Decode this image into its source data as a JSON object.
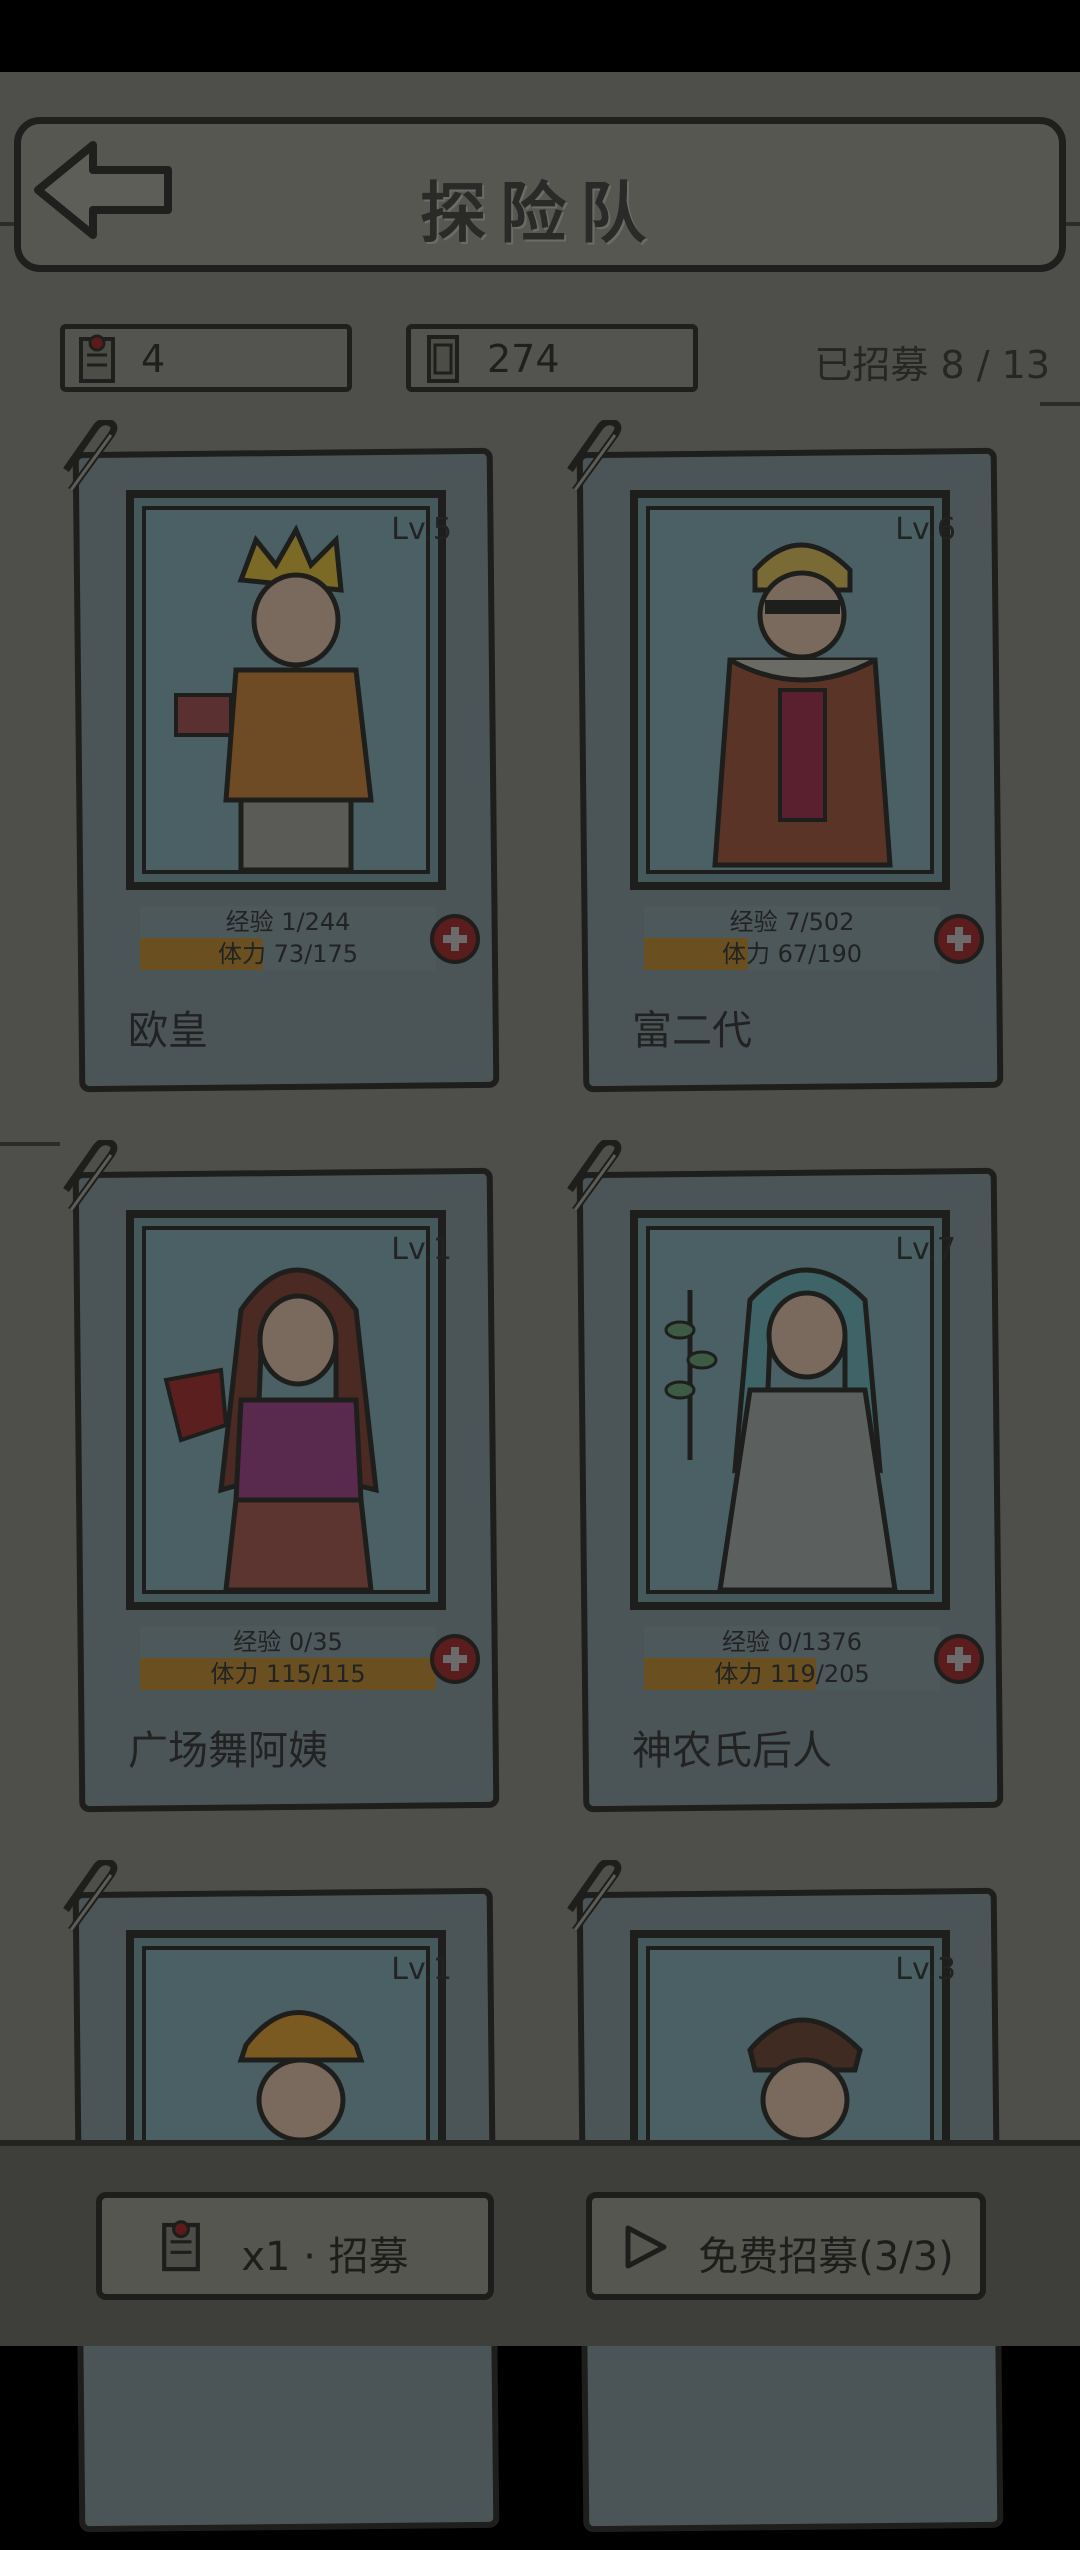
{
  "header": {
    "title": "探险队"
  },
  "resources": {
    "ticket_count": "4",
    "coin_count": "274",
    "recruited_text": "已招募 8 / 13"
  },
  "heroes": [
    {
      "level": "Lv.5",
      "exp": "经验 1/244",
      "stamina": "体力 73/175",
      "stamina_ratio": 0.417,
      "name": "欧皇"
    },
    {
      "level": "Lv.6",
      "exp": "经验 7/502",
      "stamina": "体力 67/190",
      "stamina_ratio": 0.353,
      "name": "富二代"
    },
    {
      "level": "Lv.1",
      "exp": "经验 0/35",
      "stamina": "体力 115/115",
      "stamina_ratio": 1.0,
      "name": "广场舞阿姨"
    },
    {
      "level": "Lv.7",
      "exp": "经验 0/1376",
      "stamina": "体力 119/205",
      "stamina_ratio": 0.58,
      "name": "神农氏后人"
    },
    {
      "level": "Lv.1",
      "name": ""
    },
    {
      "level": "Lv.3",
      "name": ""
    }
  ],
  "actions": {
    "recruit_label": "x1 · 招募",
    "free_recruit_label": "免费招募(3/3)"
  },
  "colors": {
    "dim_overlay": "#000000",
    "stamina_bar": "#c8921a",
    "add_button": "#b01818"
  },
  "icons": {
    "back": "back-arrow-icon",
    "ticket": "recruit-ticket-icon",
    "coin": "coin-note-icon",
    "add": "plus-icon",
    "play": "play-video-icon",
    "clip": "paperclip-icon"
  }
}
